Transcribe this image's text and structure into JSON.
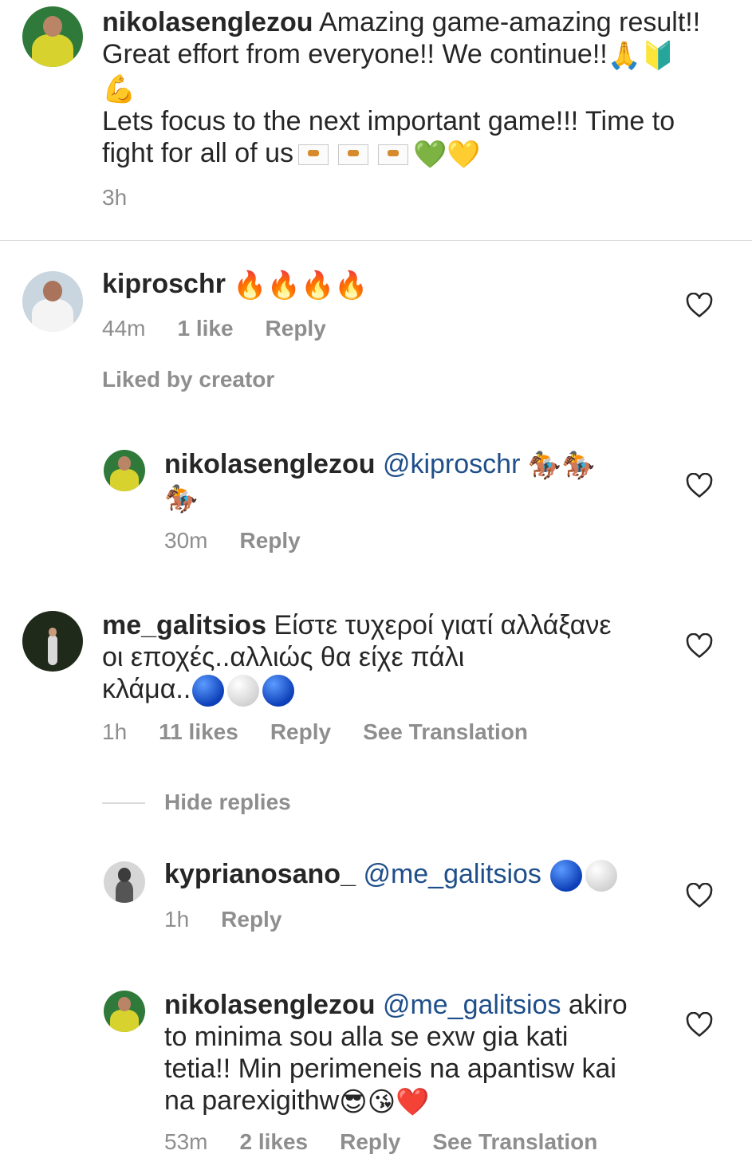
{
  "caption": {
    "username": "nikolasenglezou",
    "line1": "Amazing game-amazing result!!",
    "line2": "Great effort from everyone!! We continue!!",
    "line2_emoji": [
      "🙏",
      "🔰"
    ],
    "line3_emoji": "💪",
    "line4": "Lets focus to the next important game!!! Time to",
    "line5": "fight for all of us",
    "line5_hearts": [
      "💚",
      "💛"
    ],
    "time": "3h"
  },
  "comments": [
    {
      "username": "kiproschr",
      "emoji": "🔥🔥🔥🔥",
      "time": "44m",
      "likes": "1 like",
      "reply": "Reply",
      "liked_by": "Liked by creator"
    },
    {
      "username": "nikolasenglezou",
      "mention": "@kiproschr",
      "emoji_line1": "🏇🏇",
      "emoji_line2": "🏇",
      "time": "30m",
      "reply": "Reply"
    },
    {
      "username": "me_galitsios",
      "line1": "Είστε τυχεροί γιατί αλλάξανε",
      "line2": "οι εποχές..αλλιώς θα είχε πάλι",
      "line3": "κλάμα..",
      "time": "1h",
      "likes": "11 likes",
      "reply": "Reply",
      "translation": "See Translation",
      "hide_replies": "Hide replies"
    },
    {
      "username": "kyprianosano_",
      "mention": "@me_galitsios",
      "time": "1h",
      "reply": "Reply"
    },
    {
      "username": "nikolasenglezou",
      "mention": "@me_galitsios",
      "line1": "akiro",
      "line2": "to minima sou alla se exw gia kati",
      "line3": "tetia!! Min perimeneis na apantisw kai",
      "line4": "na parexigithw",
      "emoji": [
        "😎",
        "😘",
        "❤️"
      ],
      "time": "53m",
      "likes": "2 likes",
      "reply": "Reply",
      "translation": "See Translation"
    }
  ],
  "colors": {
    "mention": "#1f4f8a",
    "meta": "#8e8e8e",
    "text": "#262626",
    "divider": "#dbdbdb"
  }
}
